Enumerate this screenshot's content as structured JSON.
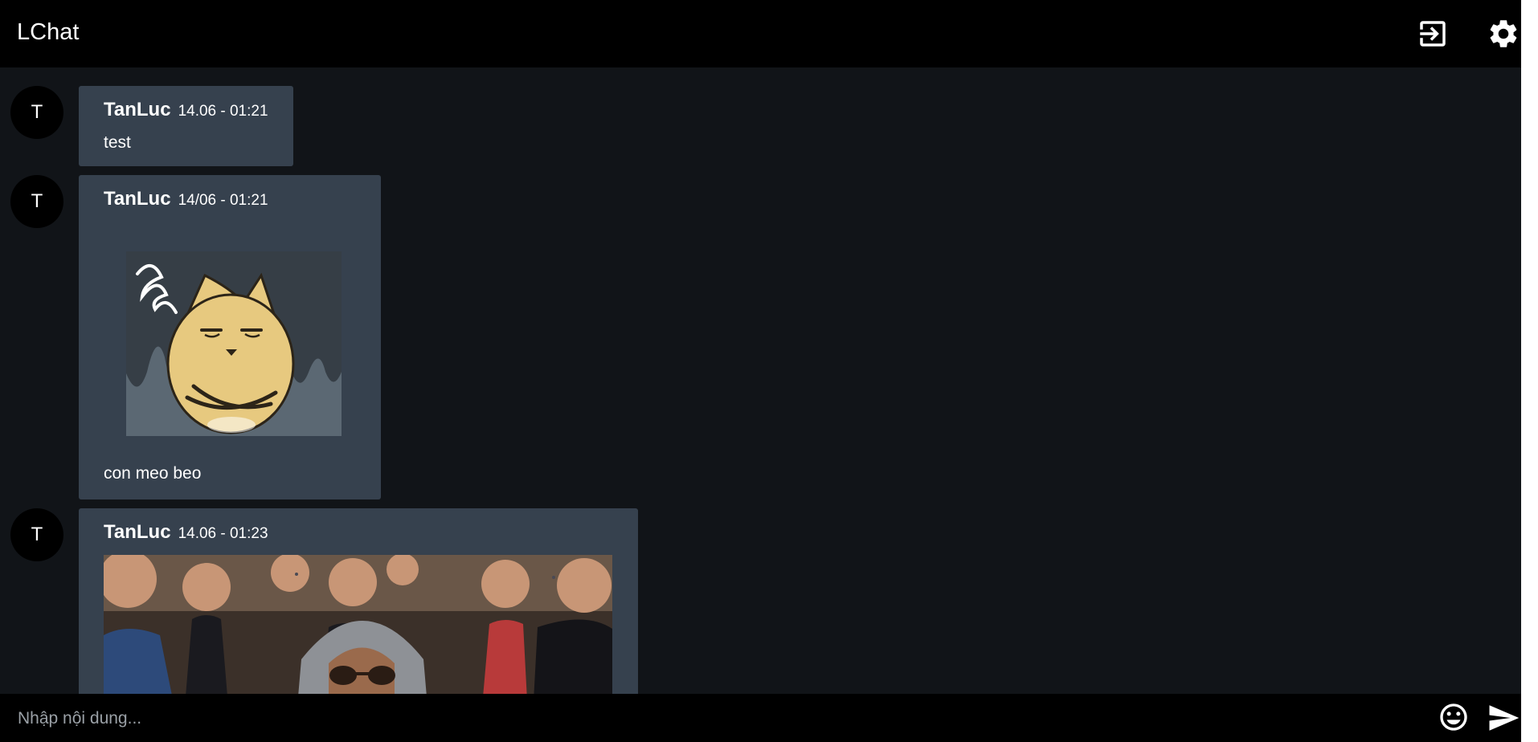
{
  "header": {
    "title": "LChat",
    "logout_icon": "logout-icon",
    "settings_icon": "gear-icon"
  },
  "messages": [
    {
      "avatar": "T",
      "user": "TanLuc",
      "time": "14.06 - 01:21",
      "text": "test"
    },
    {
      "avatar": "T",
      "user": "TanLuc",
      "time": "14/06 - 01:21",
      "sticker": "grumpy-cat-sticker",
      "text": "con meo beo"
    },
    {
      "avatar": "T",
      "user": "TanLuc",
      "time": "14.06 - 01:23",
      "image": "audience-gif"
    }
  ],
  "composer": {
    "placeholder": "Nhập nội dung...",
    "value": "",
    "emoji_icon": "emoji-icon",
    "send_icon": "send-icon"
  },
  "colors": {
    "background": "#111418",
    "bar": "#000000",
    "bubble": "#36414e",
    "text": "#ffffff"
  }
}
